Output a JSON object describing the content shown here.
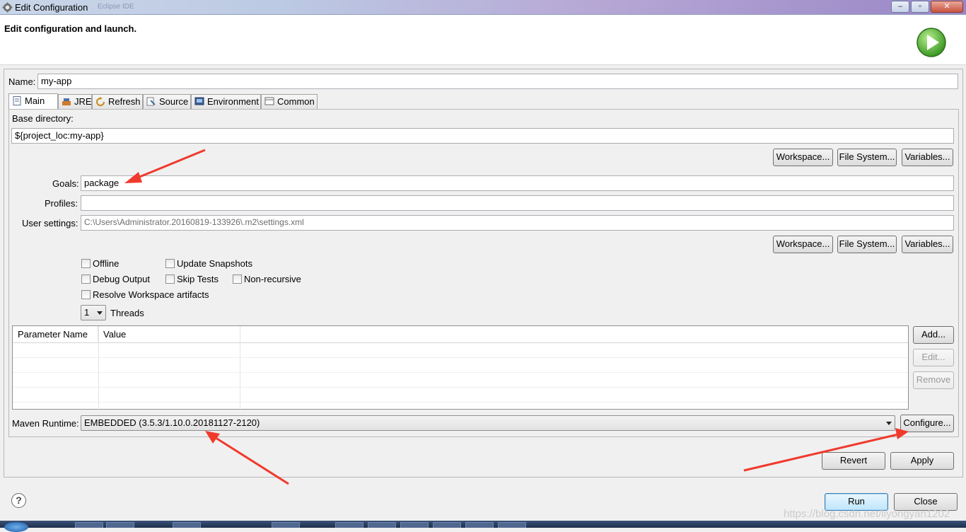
{
  "window": {
    "title": "Edit Configuration",
    "faded_title": "Eclipse IDE"
  },
  "banner": {
    "heading": "Edit configuration and launch."
  },
  "name_field": {
    "label": "Name:",
    "value": "my-app"
  },
  "tabs": [
    {
      "label": "Main",
      "icon": "page-icon"
    },
    {
      "label": "JRE",
      "icon": "jre-icon"
    },
    {
      "label": "Refresh",
      "icon": "refresh-icon"
    },
    {
      "label": "Source",
      "icon": "source-icon"
    },
    {
      "label": "Environment",
      "icon": "environment-icon"
    },
    {
      "label": "Common",
      "icon": "common-icon"
    }
  ],
  "main": {
    "base_dir_label": "Base directory:",
    "base_dir_value": "${project_loc:my-app}",
    "buttons1": {
      "workspace": "Workspace...",
      "filesystem": "File System...",
      "variables": "Variables..."
    },
    "goals_label": "Goals:",
    "goals_value": "package",
    "profiles_label": "Profiles:",
    "profiles_value": "",
    "user_settings_label": "User settings:",
    "user_settings_value": "C:\\Users\\Administrator.20160819-133926\\.m2\\settings.xml",
    "buttons2": {
      "workspace": "Workspace...",
      "filesystem": "File System...",
      "variables": "Variables..."
    },
    "checkboxes": {
      "offline": "Offline",
      "update_snapshots": "Update Snapshots",
      "debug_output": "Debug Output",
      "skip_tests": "Skip Tests",
      "non_recursive": "Non-recursive",
      "resolve_workspace": "Resolve Workspace artifacts"
    },
    "threads_value": "1",
    "threads_label": "Threads",
    "table": {
      "col_name": "Parameter Name",
      "col_value": "Value"
    },
    "table_buttons": {
      "add": "Add...",
      "edit": "Edit...",
      "remove": "Remove"
    },
    "runtime_label": "Maven Runtime:",
    "runtime_value": "EMBEDDED (3.5.3/1.10.0.20181127-2120)",
    "configure": "Configure..."
  },
  "actions": {
    "revert": "Revert",
    "apply": "Apply",
    "run": "Run",
    "close": "Close"
  },
  "help": "?",
  "watermark": "https://blog.csdn.net/liyongyan1202",
  "colors": {
    "arrow": "#f03a2e",
    "run_icon": "#3aa31e"
  }
}
